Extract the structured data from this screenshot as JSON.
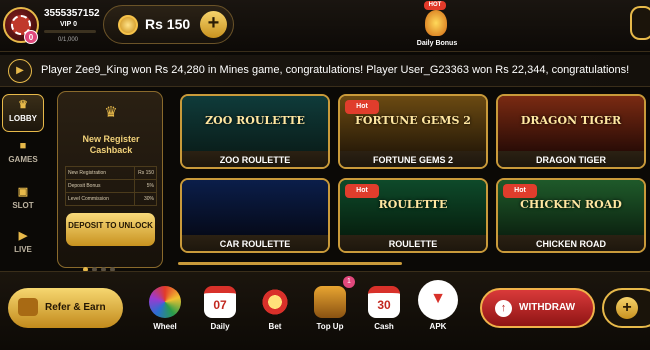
{
  "header": {
    "user_id": "3555357152",
    "vip_label": "VIP 0",
    "vip_progress": "0/1,000",
    "avatar_badge": "0",
    "balance": "Rs 150",
    "add_icon": "+",
    "bonus_hot": "HOT",
    "bonus_label": "Daily Bonus"
  },
  "ticker": {
    "message": "Player Zee9_King won Rs 24,280 in Mines game, congratulations! Player User_G23363 won Rs 22,344, congratulations!"
  },
  "sidebar": {
    "items": [
      {
        "label": "LOBBY",
        "icon": "crown-icon"
      },
      {
        "label": "GAMES",
        "icon": "games-icon"
      },
      {
        "label": "SLOT",
        "icon": "slot-icon"
      },
      {
        "label": "LIVE",
        "icon": "live-icon"
      }
    ]
  },
  "cashback": {
    "title": "New Register Cashback",
    "rows": [
      {
        "label": "New Registration",
        "value": "Rs 150"
      },
      {
        "label": "Deposit Bonus",
        "value": "5%"
      },
      {
        "label": "Level Commission",
        "value": "30%"
      }
    ],
    "button": "DEPOSIT TO UNLOCK"
  },
  "games": [
    {
      "name": "ZOO ROULETTE",
      "logo": "ZOO ROULETTE",
      "hot": "",
      "colors": [
        "#0f3b3a",
        "#0a1f1c"
      ]
    },
    {
      "name": "FORTUNE GEMS 2",
      "logo": "FORTUNE GEMS 2",
      "hot": "Hot",
      "colors": [
        "#6b4a12",
        "#2a1c08"
      ]
    },
    {
      "name": "DRAGON TIGER",
      "logo": "DRAGON TIGER",
      "hot": "",
      "colors": [
        "#7a2a12",
        "#2a0c06"
      ]
    },
    {
      "name": "CAR ROULETTE",
      "logo": "",
      "hot": "",
      "colors": [
        "#0b1e4a",
        "#050a1a"
      ]
    },
    {
      "name": "ROULETTE",
      "logo": "ROULETTE",
      "hot": "Hot",
      "colors": [
        "#0e4a2a",
        "#06200f"
      ]
    },
    {
      "name": "CHICKEN ROAD",
      "logo": "CHICKEN ROAD",
      "hot": "Hot",
      "colors": [
        "#1f5a2a",
        "#0c2411"
      ]
    }
  ],
  "bottom": {
    "refer": "Refer & Earn",
    "wheel": "Wheel",
    "daily": "Daily",
    "daily_num": "07",
    "bet": "Bet",
    "topup": "Top Up",
    "topup_badge": "1",
    "cash": "Cash",
    "cash_num": "30",
    "apk": "APK",
    "withdraw": "WITHDRAW"
  }
}
